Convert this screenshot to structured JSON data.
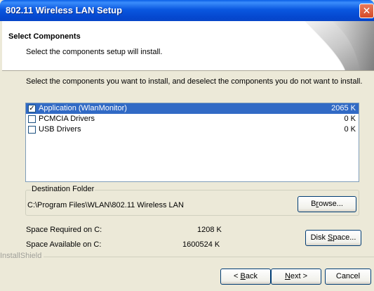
{
  "window": {
    "title": "802.11 Wireless LAN Setup",
    "close_glyph": "✕"
  },
  "header": {
    "title": "Select Components",
    "subtitle": "Select the components setup will install."
  },
  "instructions": "Select the components you want to install, and deselect the components you do not want to install.",
  "components": [
    {
      "label": "Application (WlanMonitor)",
      "size": "2065 K",
      "checked": true,
      "selected": true
    },
    {
      "label": "PCMCIA Drivers",
      "size": "0 K",
      "checked": false,
      "selected": false
    },
    {
      "label": "USB Drivers",
      "size": "0 K",
      "checked": false,
      "selected": false
    }
  ],
  "destination": {
    "legend": "Destination Folder",
    "path": "C:\\Program Files\\WLAN\\802.11 Wireless LAN",
    "browse": {
      "pre": "B",
      "key": "r",
      "post": "owse..."
    }
  },
  "space": {
    "required_label": "Space Required on C:",
    "required_value": "1208 K",
    "available_label": "Space Available on C:",
    "available_value": "1600524 K",
    "disk_button": {
      "pre": "Disk ",
      "key": "S",
      "post": "pace..."
    }
  },
  "brand": "InstallShield",
  "buttons": {
    "back": {
      "pre": "< ",
      "key": "B",
      "post": "ack"
    },
    "next": {
      "pre": "",
      "key": "N",
      "post": "ext >"
    },
    "cancel": "Cancel"
  },
  "colors": {
    "title_bar": "#0a58e0",
    "selection": "#316ac5",
    "dialog_bg": "#ece9d8"
  }
}
